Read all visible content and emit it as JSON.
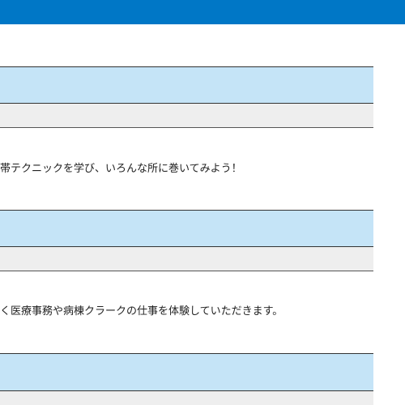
{
  "colors": {
    "header_bar": "#0077c6",
    "section_head": "#c5e4f7",
    "section_row": "#eeeeee"
  },
  "sections": [
    {
      "description": "帯テクニックを学び、いろんな所に巻いてみよう！"
    },
    {
      "description": "く医療事務や病棟クラークの仕事を体験していただきます。"
    },
    {
      "description": ""
    }
  ]
}
